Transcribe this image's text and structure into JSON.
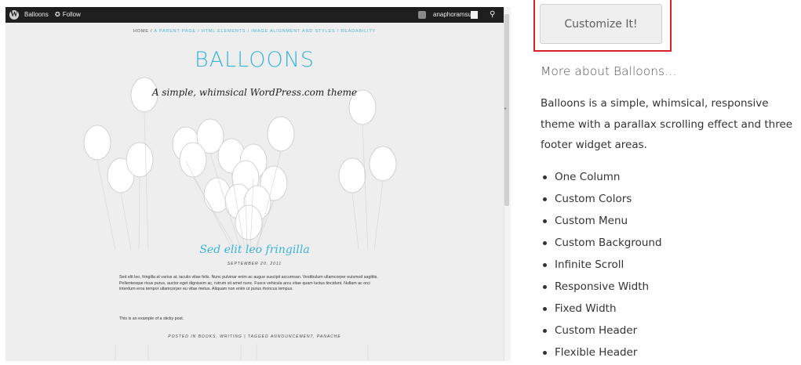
{
  "wpbar": {
    "site_name": "Balloons",
    "follow_label": "Follow",
    "username": "anaphoramsu",
    "icons": [
      "wordpress-logo-icon",
      "follow-star-icon",
      "avatar",
      "search-icon"
    ]
  },
  "preview": {
    "breadcrumb": {
      "home": "HOME /",
      "items": [
        "A PARENT PAGE /",
        "HTML ELEMENTS /",
        "IMAGE ALIGNMENT AND STYLES /",
        "READABILITY"
      ]
    },
    "site_title": "BALLOONS",
    "tagline": "A simple, whimsical WordPress.com theme",
    "post_title": "Sed elit leo fringilla",
    "post_date": "SEPTEMBER 20, 2011",
    "post_body": "Sed elit leo, fringilla at varius at, iaculis vitae felis. Nunc pulvinar enim ac augue suscipit accumsan. Vestibulum ullamcorper euismod sagittis. Pellentesque risus purus, auctor eget dignissim ac, rutrum sit amet nunc. Fusce vehicula arcu vitae quam luctus tincidunt. Nullam ac orci interdum eros tempor ullamcorper eu vitae metus. Aliquam non enim ut purus rhoncus tempus.",
    "sticky_note": "This is an example of a sticky post.",
    "post_meta": "POSTED IN BOOKS, WRITING | TAGGED ANNOUNCEMENT, PANACHE",
    "accent_color": "#3ab5d8"
  },
  "panel": {
    "customize_label": "Customize It!",
    "more_heading": "More about Balloons…",
    "description": "Balloons is a simple, whimsical, responsive theme with a parallax scrolling effect and three footer widget areas.",
    "features": [
      "One Column",
      "Custom Colors",
      "Custom Menu",
      "Custom Background",
      "Infinite Scroll",
      "Responsive Width",
      "Fixed Width",
      "Custom Header",
      "Flexible Header"
    ],
    "highlight_color": "#d9202a"
  }
}
